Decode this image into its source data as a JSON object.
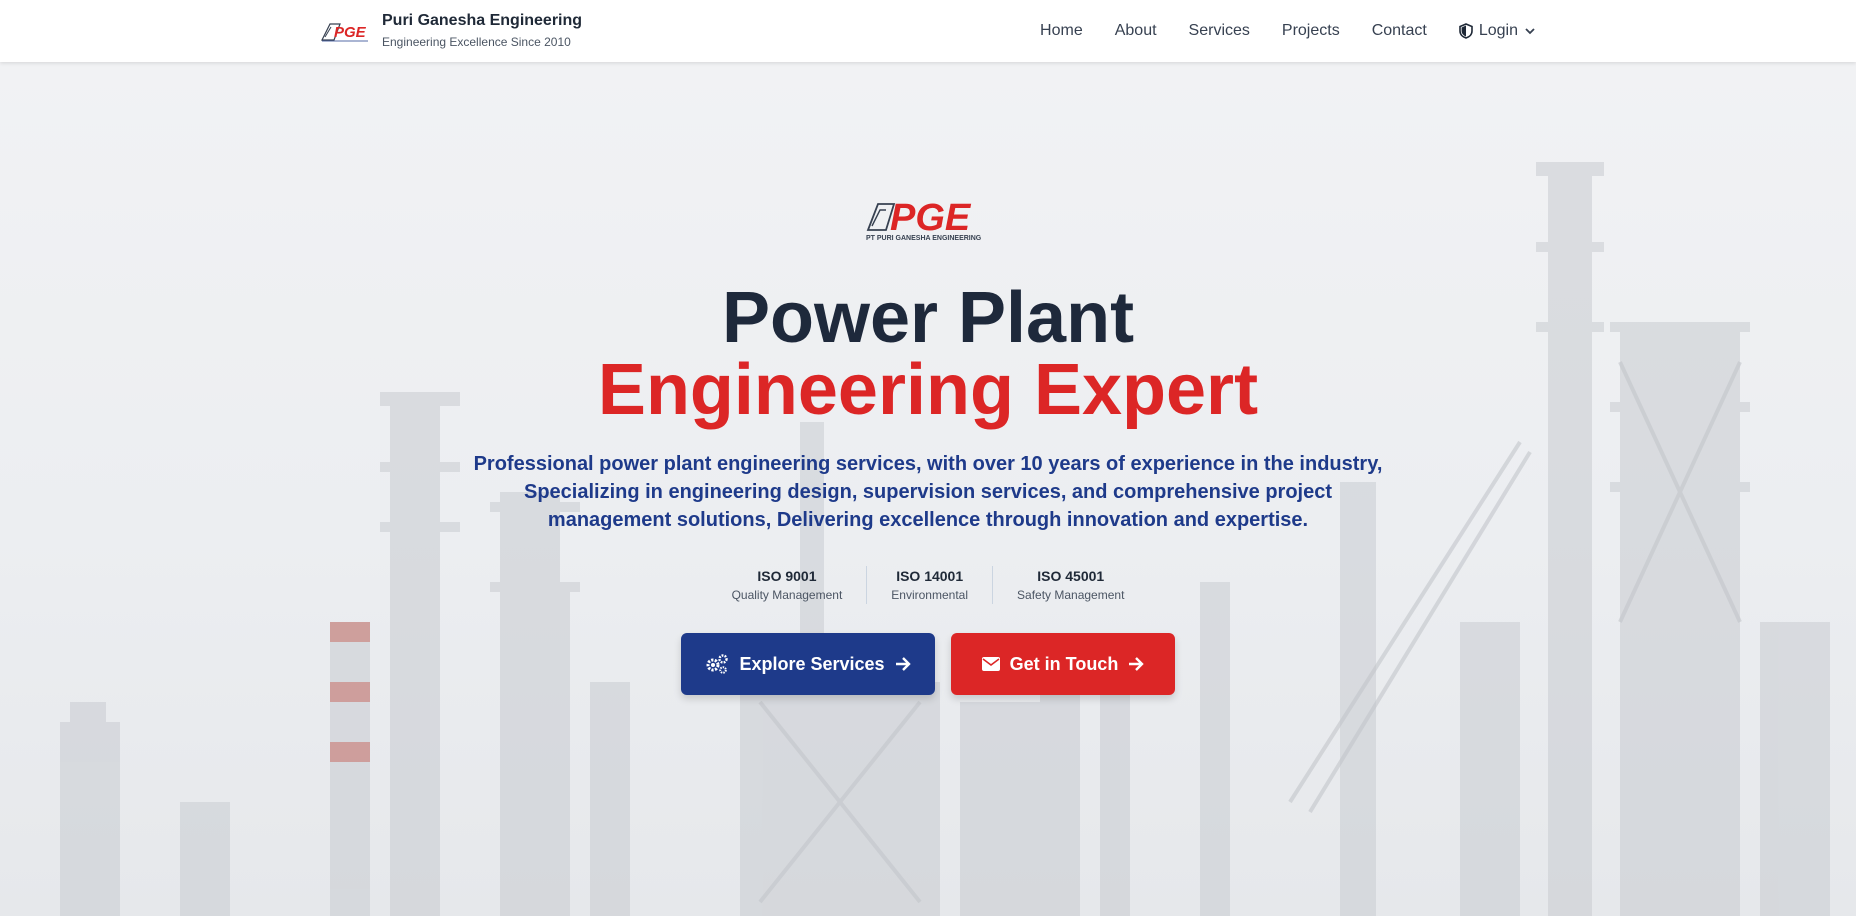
{
  "header": {
    "logo_text": "PGE",
    "brand_name": "Puri Ganesha Engineering",
    "tagline": "Engineering Excellence Since 2010",
    "nav": [
      {
        "label": "Home"
      },
      {
        "label": "About"
      },
      {
        "label": "Services"
      },
      {
        "label": "Projects"
      },
      {
        "label": "Contact"
      }
    ],
    "login_label": "Login"
  },
  "hero": {
    "logo_text": "PGE",
    "logo_subtext": "PT PURI GANESHA ENGINEERING",
    "title_line1": "Power Plant",
    "title_line2": "Engineering Expert",
    "description": "Professional power plant engineering services, with over 10 years of experience in the industry, Specializing in engineering design, supervision services, and comprehensive project management solutions, Delivering excellence through innovation and expertise.",
    "certifications": [
      {
        "name": "ISO 9001",
        "desc": "Quality Management"
      },
      {
        "name": "ISO 14001",
        "desc": "Environmental"
      },
      {
        "name": "ISO 45001",
        "desc": "Safety Management"
      }
    ],
    "primary_button": "Explore Services",
    "secondary_button": "Get in Touch"
  },
  "icons": {
    "login": "shield-icon",
    "login_chevron": "chevron-down-icon",
    "primary_button": "gears-icon",
    "primary_arrow": "arrow-right-icon",
    "secondary_button": "envelope-icon",
    "secondary_arrow": "arrow-right-icon"
  },
  "colors": {
    "brand_navy": "#1e3a8a",
    "brand_red": "#dc2626",
    "title_dark": "#1e293b"
  }
}
